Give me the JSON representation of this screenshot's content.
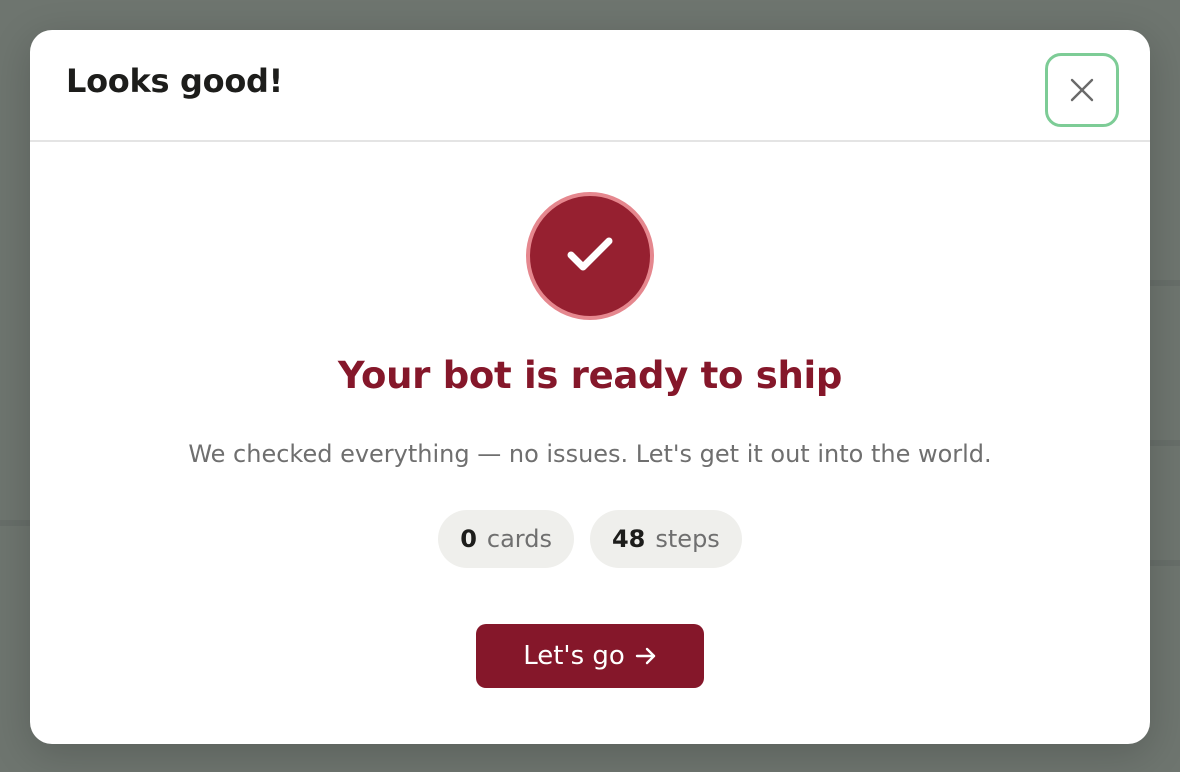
{
  "dialog": {
    "title": "Looks good!",
    "close_label": "Close"
  },
  "result": {
    "headline": "Your bot is ready to ship",
    "message": "We checked everything — no issues. Let's get it out into the world."
  },
  "stats": [
    {
      "value": "0",
      "label": "cards"
    },
    {
      "value": "48",
      "label": "steps"
    }
  ],
  "actions": {
    "primary_label": "Let's go"
  },
  "icons": {
    "close": "close-icon",
    "success": "checkmark-icon",
    "arrow": "arrow-right-icon"
  },
  "colors": {
    "accent": "#85172a",
    "badge_fill": "#962030",
    "badge_ring": "#e5878e",
    "focus_ring": "#7dcc96",
    "pill_bg": "#efefec"
  }
}
